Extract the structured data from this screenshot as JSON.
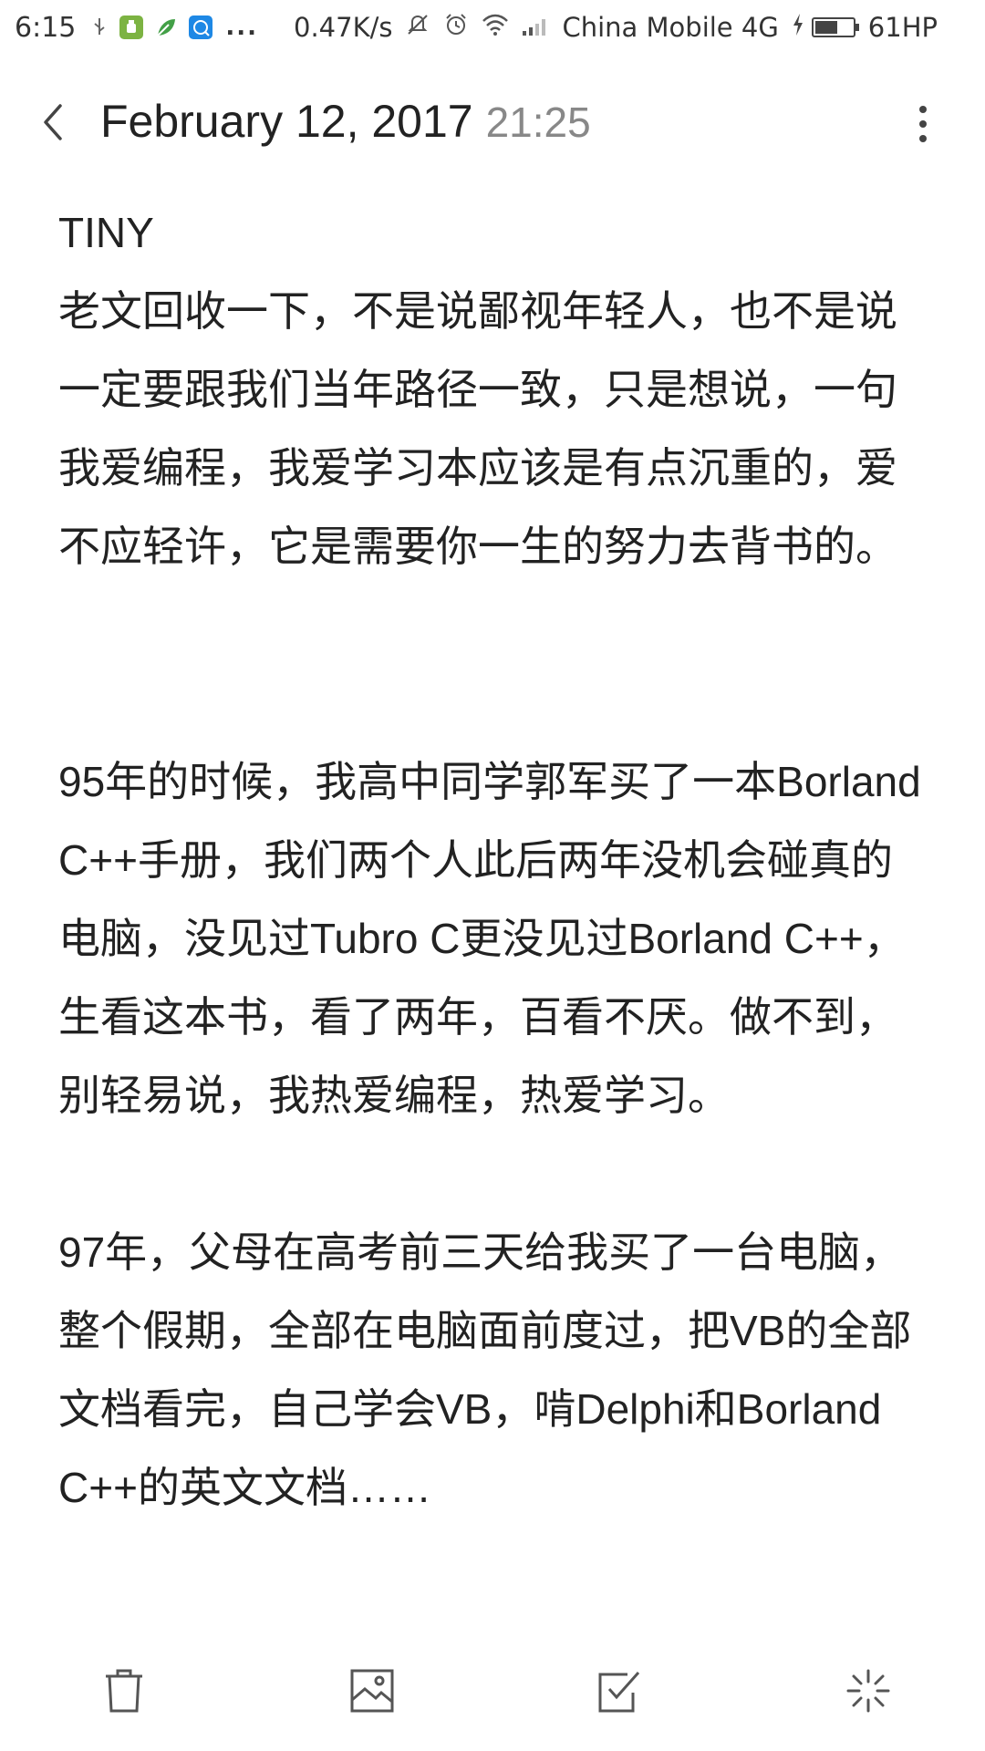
{
  "status_bar": {
    "time": "6:15",
    "network_speed": "0.47K/s",
    "carrier": "China Mobile 4G",
    "battery": "61HP",
    "battery_level_fraction": 0.61,
    "overflow_dots": "...",
    "icons": [
      "usb-icon",
      "android-app-icon",
      "leaf-app-icon",
      "browser-app-icon",
      "mute-icon",
      "alarm-icon",
      "wifi-icon",
      "signal-icon",
      "charging-icon",
      "battery-icon"
    ]
  },
  "header": {
    "date": "February 12, 2017",
    "time": "21:25",
    "icons": [
      "back-arrow-icon",
      "more-vertical-icon"
    ]
  },
  "note": {
    "title": "TINY",
    "paragraph1": "老文回收一下，不是说鄙视年轻人，也不是说一定要跟我们当年路径一致，只是想说，一句我爱编程，我爱学习本应该是有点沉重的，爱不应轻许，它是需要你一生的努力去背书的。",
    "paragraph2": "95年的时候，我高中同学郭军买了一本Borland C++手册，我们两个人此后两年没机会碰真的电脑，没见过Tubro C更没见过Borland C++，生看这本书，看了两年，百看不厌。做不到，别轻易说，我热爱编程，热爱学习。",
    "paragraph3": "97年，父母在高考前三天给我买了一台电脑，整个假期，全部在电脑面前度过，把VB的全部文档看完，自己学会VB，啃Delphi和Borland C++的英文文档……"
  },
  "toolbar": {
    "icons": [
      "delete-icon",
      "image-icon",
      "checklist-icon",
      "sparkle-icon"
    ]
  },
  "colors": {
    "text": "#222222",
    "muted": "#888888",
    "icon": "#555555",
    "background": "#ffffff"
  }
}
